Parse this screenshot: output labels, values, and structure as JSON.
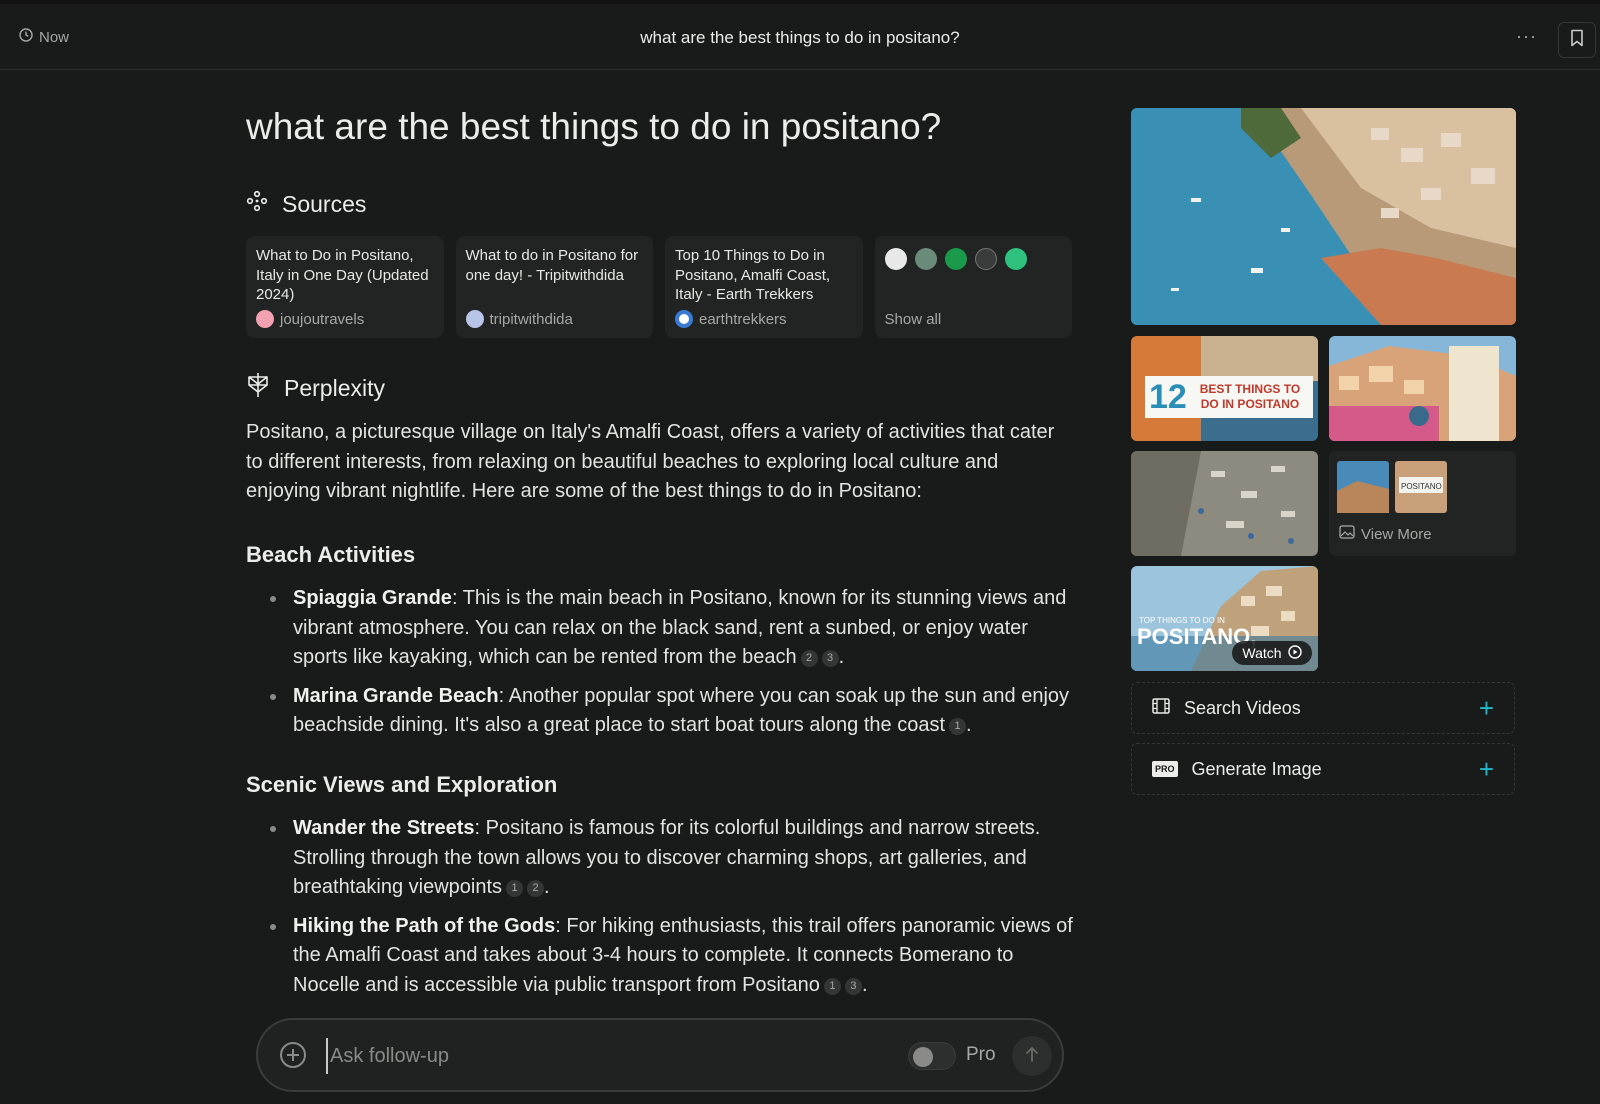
{
  "topbar": {
    "time_label": "Now",
    "title": "what are the best things to do in positano?",
    "more_label": "···"
  },
  "question": "what are the best things to do in positano?",
  "sources": {
    "heading": "Sources",
    "cards": [
      {
        "title": "What to Do in Positano, Italy in One Day (Updated 2024)",
        "site": "joujoutravels",
        "color": "#f3a0b0"
      },
      {
        "title": "What to do in Positano for one day! - Tripitwithdida",
        "site": "tripitwithdida",
        "color": "#b8c4e8"
      },
      {
        "title": "Top 10 Things to Do in Positano, Amalfi Coast, Italy - Earth Trekkers",
        "site": "earthtrekkers",
        "color": "#3a7bd5"
      }
    ],
    "show_all_label": "Show all",
    "extra_favicons": [
      "#e8e8e8",
      "#6a8a7a",
      "#1a9a4a",
      "#d8d8d8",
      "#2ec27e"
    ]
  },
  "answer": {
    "heading": "Perplexity",
    "intro": "Positano, a picturesque village on Italy's Amalfi Coast, offers a variety of activities that cater to different interests, from relaxing on beautiful beaches to exploring local culture and enjoying vibrant nightlife. Here are some of the best things to do in Positano:",
    "sections": [
      {
        "title": "Beach Activities",
        "items": [
          {
            "bold": "Spiaggia Grande",
            "text": ": This is the main beach in Positano, known for its stunning views and vibrant atmosphere. You can relax on the black sand, rent a sunbed, or enjoy water sports like kayaking, which can be rented from the beach",
            "cites": [
              "2",
              "3"
            ]
          },
          {
            "bold": "Marina Grande Beach",
            "text": ": Another popular spot where you can soak up the sun and enjoy beachside dining. It's also a great place to start boat tours along the coast",
            "cites": [
              "1"
            ]
          }
        ]
      },
      {
        "title": "Scenic Views and Exploration",
        "items": [
          {
            "bold": "Wander the Streets",
            "text": ": Positano is famous for its colorful buildings and narrow streets. Strolling through the town allows you to discover charming shops, art galleries, and breathtaking viewpoints",
            "cites": [
              "1",
              "2"
            ]
          },
          {
            "bold": "Hiking the Path of the Gods",
            "text": ": For hiking enthusiasts, this trail offers panoramic views of the Amalfi Coast and takes about 3-4 hours to complete. It connects Bomerano to Nocelle and is accessible via public transport from Positano",
            "cites": [
              "1",
              "3"
            ]
          }
        ]
      }
    ]
  },
  "followup": {
    "placeholder": "Ask follow-up",
    "pro_label": "Pro",
    "pro_enabled": false
  },
  "sidebar": {
    "thumb_1_big": "12",
    "thumb_1_text": "BEST THINGS TO DO IN POSITANO",
    "view_more_label": "View More",
    "mini_thumb_text": "POSITANO",
    "video_overlay_small": "TOP THINGS TO DO IN",
    "video_overlay_big": "POSITANO, ITALY",
    "watch_label": "Watch",
    "search_videos_label": "Search Videos",
    "generate_image_label": "Generate Image",
    "pro_badge": "PRO",
    "accent_color": "#20b8cd"
  }
}
